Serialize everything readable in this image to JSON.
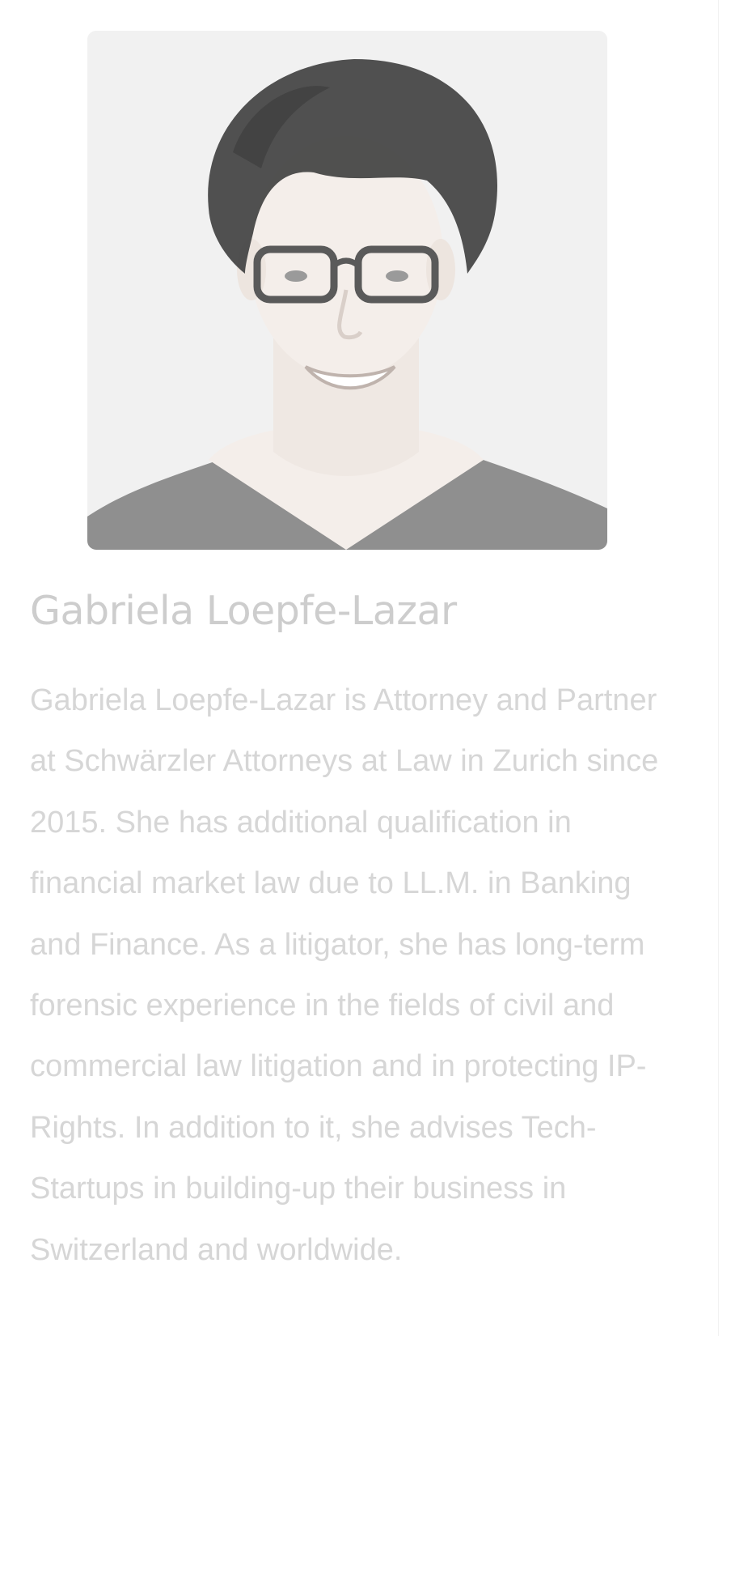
{
  "profile": {
    "photo": {
      "alt": "Portrait of Gabriela Loepfe-Lazar",
      "colors": {
        "background": "#f1f1f1",
        "hair": "#474747",
        "skin": "#f4eeea",
        "shirt": "#6e6e6e",
        "glasses": "#5a5a5a"
      }
    },
    "name": "Gabriela Loepfe-Lazar",
    "bio": "Gabriela Loepfe-Lazar is Attorney and Partner at Schwärzler Attorneys at Law in Zurich since 2015. She has additional qualification in financial market law due to LL.M. in Banking and Finance. As a litigator, she has long-term forensic experience in the fields of civil and commercial law litigation and in protecting IP-Rights. In addition to it, she advises Tech-Startups in building-up their business in Switzerland and worldwide."
  },
  "theme": {
    "name_color": "#cdcdcd",
    "bio_color": "#d6d6d6",
    "background": "#ffffff"
  }
}
